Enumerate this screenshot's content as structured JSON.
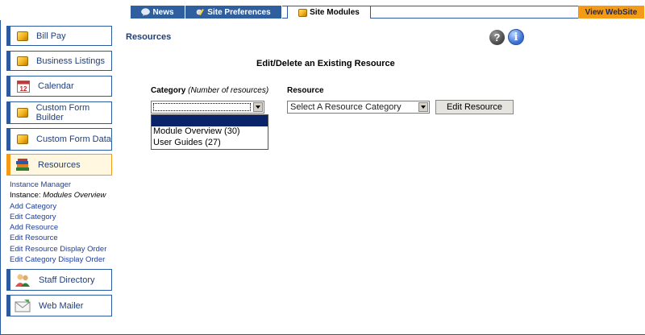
{
  "topnav": {
    "tabs": [
      {
        "label": "News",
        "icon": "news-bubble-icon"
      },
      {
        "label": "Site Preferences",
        "icon": "preferences-tools-icon"
      },
      {
        "label": "Site Modules",
        "icon": "module-cube-icon"
      }
    ],
    "view_site": "View WebSite"
  },
  "sidebar": {
    "modules": [
      {
        "label": "Bill Pay",
        "icon": "module-cube-icon"
      },
      {
        "label": "Business Listings",
        "icon": "module-cube-icon"
      },
      {
        "label": "Calendar",
        "icon": "calendar-icon",
        "calendar_day": "12"
      },
      {
        "label": "Custom Form Builder",
        "icon": "module-cube-icon"
      },
      {
        "label": "Custom Form Data",
        "icon": "module-cube-icon"
      },
      {
        "label": "Resources",
        "icon": "books-stack-icon"
      },
      {
        "label": "Staff Directory",
        "icon": "people-icon"
      },
      {
        "label": "Web Mailer",
        "icon": "envelope-icon"
      }
    ],
    "sublinks": {
      "instance_manager": "Instance Manager",
      "instance_prefix": "Instance: ",
      "instance_name": "Modules Overview",
      "add_category": "Add Category",
      "edit_category": "Edit Category",
      "add_resource": "Add Resource",
      "edit_resource": "Edit Resource",
      "edit_resource_order": "Edit Resource Display Order",
      "edit_category_order": "Edit Category Display Order"
    }
  },
  "main": {
    "page_title": "Resources",
    "help_icon_glyph": "?",
    "info_icon_glyph": "i",
    "form_title": "Edit/Delete an Existing Resource",
    "category_label": "Category",
    "category_hint": "(Number of resources)",
    "resource_label": "Resource",
    "category_select_value": "",
    "category_options": [
      "",
      "Module Overview (30)",
      "User Guides (27)"
    ],
    "resource_select_value": "Select A Resource Category",
    "edit_button": "Edit Resource"
  },
  "colors": {
    "nav_blue": "#2f5f9e",
    "accent_orange": "#f39a17",
    "link_blue": "#1f3f9a",
    "selection_navy": "#0a246a"
  }
}
